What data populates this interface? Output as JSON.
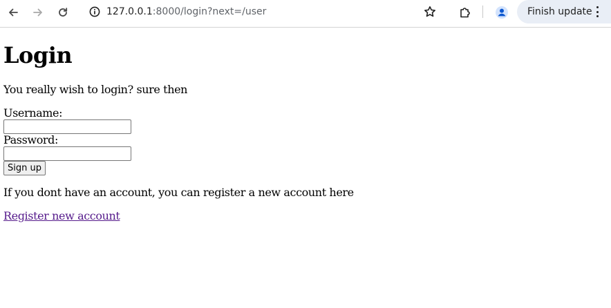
{
  "browser": {
    "url_host": "127.0.0.1",
    "url_rest": ":8000/login?next=/user",
    "update_label": "Finish update",
    "icons": {
      "back": "arrow-left-icon",
      "forward": "arrow-right-icon",
      "reload": "reload-icon",
      "site_info": "info-icon",
      "bookmark": "star-icon",
      "extensions": "puzzle-icon",
      "profile": "person-icon",
      "menu": "three-dots-icon"
    },
    "colors": {
      "toolbar_bg": "#ffffff",
      "chip_bg": "#e9eef6",
      "profile_accent": "#0b57d0"
    }
  },
  "page": {
    "title": "Login",
    "intro": "You really wish to login? sure then",
    "form": {
      "username_label": "Username:",
      "username_value": "",
      "password_label": "Password:",
      "password_value": "",
      "submit_label": "Sign up"
    },
    "register_note": "If you dont have an account, you can register a new account here",
    "register_link": "Register new account",
    "colors": {
      "link_visited": "#551a8b"
    }
  }
}
